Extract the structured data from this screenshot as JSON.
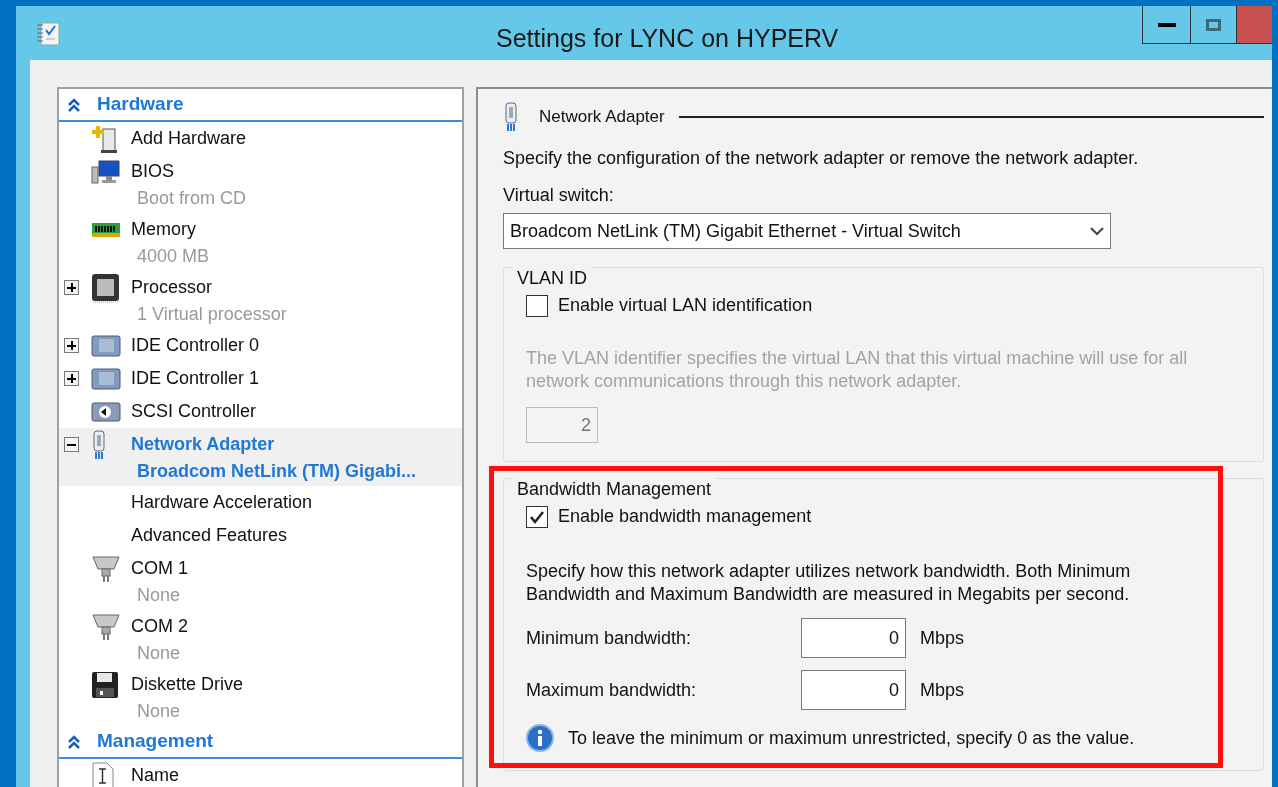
{
  "window": {
    "title": "Settings for LYNC on HYPERV"
  },
  "tree": {
    "sections": [
      {
        "label": "Hardware",
        "expanded": true,
        "items": [
          {
            "label": "Add Hardware",
            "selected": false
          },
          {
            "label": "BIOS",
            "detail": "Boot from CD",
            "selected": false
          },
          {
            "label": "Memory",
            "detail": "4000 MB",
            "selected": false
          },
          {
            "label": "Processor",
            "detail": "1 Virtual processor",
            "expanded": false,
            "selected": false
          },
          {
            "label": "IDE Controller 0",
            "expanded": false,
            "selected": false
          },
          {
            "label": "IDE Controller 1",
            "expanded": false,
            "selected": false
          },
          {
            "label": "SCSI Controller",
            "selected": false
          },
          {
            "label": "Network Adapter",
            "detail": "Broadcom NetLink (TM) Gigabi...",
            "expanded": true,
            "selected": true,
            "children": [
              {
                "label": "Hardware Acceleration",
                "selected": false
              },
              {
                "label": "Advanced Features",
                "selected": false
              }
            ]
          },
          {
            "label": "COM 1",
            "detail": "None",
            "selected": false
          },
          {
            "label": "COM 2",
            "detail": "None",
            "selected": false
          },
          {
            "label": "Diskette Drive",
            "detail": "None",
            "selected": false
          }
        ]
      },
      {
        "label": "Management",
        "expanded": true,
        "items": [
          {
            "label": "Name",
            "selected": false
          }
        ]
      }
    ]
  },
  "detail": {
    "heading": "Network Adapter",
    "description": "Specify the configuration of the network adapter or remove the network adapter.",
    "switch": {
      "label": "Virtual switch:",
      "value": "Broadcom NetLink (TM) Gigabit Ethernet - Virtual Switch"
    },
    "vlan": {
      "title": "VLAN ID",
      "checkbox": {
        "label": "Enable virtual LAN identification",
        "checked": false
      },
      "note": "The VLAN identifier specifies the virtual LAN that this virtual machine will use for all network communications through this network adapter.",
      "value": "2",
      "disabled": true
    },
    "bandwidth": {
      "title": "Bandwidth Management",
      "highlighted": true,
      "checkbox": {
        "label": "Enable bandwidth management",
        "checked": true
      },
      "note": "Specify how this network adapter utilizes network bandwidth. Both Minimum Bandwidth and Maximum Bandwidth are measured in Megabits per second.",
      "fields": [
        {
          "label": "Minimum bandwidth:",
          "value": "0",
          "unit": "Mbps"
        },
        {
          "label": "Maximum bandwidth:",
          "value": "0",
          "unit": "Mbps"
        }
      ],
      "info": "To leave the minimum or maximum unrestricted, specify 0 as the value."
    }
  }
}
